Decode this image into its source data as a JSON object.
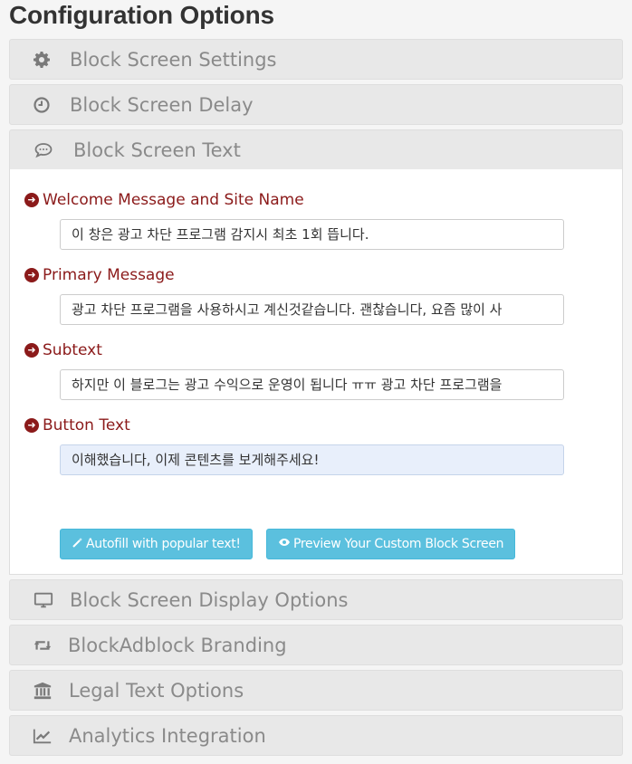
{
  "page": {
    "title": "Configuration Options"
  },
  "panels_top": [
    {
      "label": "Block Screen Settings",
      "icon": "gear-icon"
    },
    {
      "label": "Block Screen Delay",
      "icon": "clock-icon"
    },
    {
      "label": "Block Screen Text",
      "icon": "speech-bubble-icon"
    }
  ],
  "block_text": {
    "fields": [
      {
        "label": "Welcome Message and Site Name",
        "value": "이 창은 광고 차단 프로그램 감지시 최초 1회 뜹니다."
      },
      {
        "label": "Primary Message",
        "value": "광고 차단 프로그램을 사용하시고 계신것같습니다. 괜찮습니다, 요즘 많이 사"
      },
      {
        "label": "Subtext",
        "value": "하지만 이 블로그는 광고 수익으로 운영이 됩니다 ㅠㅠ 광고 차단 프로그램을"
      },
      {
        "label": "Button Text",
        "value": "이해했습니다, 이제 콘텐츠를 보게해주세요!"
      }
    ],
    "autofill_button": "Autofill with popular text!",
    "preview_button": "Preview Your Custom Block Screen"
  },
  "panels_bottom": [
    {
      "label": "Block Screen Display Options",
      "icon": "monitor-icon"
    },
    {
      "label": "BlockAdblock Branding",
      "icon": "retweet-icon"
    },
    {
      "label": "Legal Text Options",
      "icon": "bank-icon"
    },
    {
      "label": "Analytics Integration",
      "icon": "line-chart-icon"
    }
  ],
  "colors": {
    "accent_label": "#8b1a1a",
    "button": "#5bc0de",
    "panel": "#e8e8e8"
  }
}
